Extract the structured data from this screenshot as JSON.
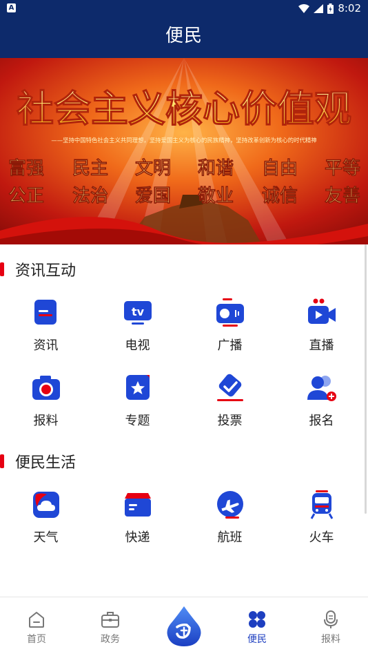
{
  "status": {
    "time": "8:02",
    "left_icon": "A"
  },
  "header": {
    "title": "便民"
  },
  "banner": {
    "headline": "社会主义核心价值观",
    "subline": "——坚持中国特色社会主义共同理想，坚持爱国主义为核心的民族精神，坚持改革创新为核心的时代精神",
    "row1": [
      "富强",
      "民主",
      "文明",
      "和谐",
      "自由",
      "平等"
    ],
    "row2": [
      "公正",
      "法治",
      "爱国",
      "敬业",
      "诚信",
      "友善"
    ]
  },
  "sections": [
    {
      "title": "资讯互动",
      "items": [
        {
          "label": "资讯",
          "icon": "news-icon"
        },
        {
          "label": "电视",
          "icon": "tv-icon"
        },
        {
          "label": "广播",
          "icon": "radio-icon"
        },
        {
          "label": "直播",
          "icon": "live-camera-icon"
        },
        {
          "label": "报料",
          "icon": "camera-icon"
        },
        {
          "label": "专题",
          "icon": "star-folder-icon"
        },
        {
          "label": "投票",
          "icon": "vote-check-icon"
        },
        {
          "label": "报名",
          "icon": "add-user-icon"
        }
      ]
    },
    {
      "title": "便民生活",
      "items": [
        {
          "label": "天气",
          "icon": "cloud-icon"
        },
        {
          "label": "快递",
          "icon": "package-icon"
        },
        {
          "label": "航班",
          "icon": "airplane-icon"
        },
        {
          "label": "火车",
          "icon": "train-icon"
        }
      ]
    }
  ],
  "bottom_nav": {
    "items": [
      {
        "label": "首页",
        "icon": "home-icon"
      },
      {
        "label": "政务",
        "icon": "briefcase-icon"
      },
      {
        "label": "",
        "icon": "center-logo-icon"
      },
      {
        "label": "便民",
        "icon": "clover-icon",
        "active": true
      },
      {
        "label": "报料",
        "icon": "microphone-icon"
      }
    ]
  },
  "colors": {
    "header": "#0d2a6b",
    "accent": "#1e3fc0",
    "section_bar": "#e60012"
  }
}
